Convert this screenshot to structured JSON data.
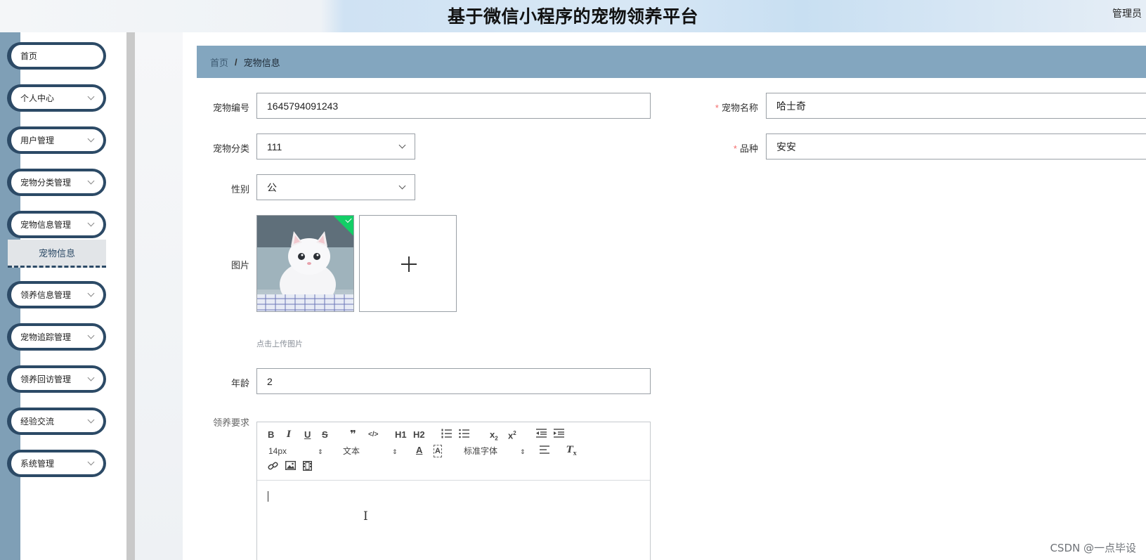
{
  "header": {
    "title": "基于微信小程序的宠物领养平台",
    "user": "管理员"
  },
  "sidebar": {
    "items": [
      {
        "label": "首页",
        "expandable": false
      },
      {
        "label": "个人中心",
        "expandable": true
      },
      {
        "label": "用户管理",
        "expandable": true
      },
      {
        "label": "宠物分类管理",
        "expandable": true
      },
      {
        "label": "宠物信息管理",
        "expandable": true
      },
      {
        "label": "领养信息管理",
        "expandable": true
      },
      {
        "label": "宠物追踪管理",
        "expandable": true
      },
      {
        "label": "领养回访管理",
        "expandable": true
      },
      {
        "label": "经验交流",
        "expandable": true
      },
      {
        "label": "系统管理",
        "expandable": true
      }
    ],
    "active_sub": "宠物信息"
  },
  "breadcrumb": {
    "home": "首页",
    "separator": "/",
    "current": "宠物信息"
  },
  "form": {
    "pet_id": {
      "label": "宠物编号",
      "value": "1645794091243"
    },
    "pet_name": {
      "label": "宠物名称",
      "value": "哈士奇",
      "required": true
    },
    "category": {
      "label": "宠物分类",
      "value": "111"
    },
    "breed": {
      "label": "品种",
      "value": "安安",
      "required": true
    },
    "gender": {
      "label": "性别",
      "value": "公"
    },
    "image": {
      "label": "图片",
      "hint": "点击上传图片"
    },
    "age": {
      "label": "年龄",
      "value": "2"
    },
    "requirements": {
      "label": "领养要求"
    }
  },
  "editor": {
    "buttons": [
      "B",
      "I",
      "U",
      "S",
      "❞",
      "</>",
      "H1",
      "H2",
      "ordered-list",
      "bullet-list",
      "x2-sub",
      "x2-sup",
      "outdent",
      "indent"
    ],
    "font_size": "14px",
    "block_format": "文本",
    "font_family": "标准字体"
  },
  "watermark": "CSDN @一点毕设",
  "colors": {
    "nav_border": "#2c4a66",
    "rail": "#7f9fb6",
    "breadcrumb_bg": "#83a6bf",
    "upload_success": "#13ce66",
    "required": "#f56c6c"
  }
}
